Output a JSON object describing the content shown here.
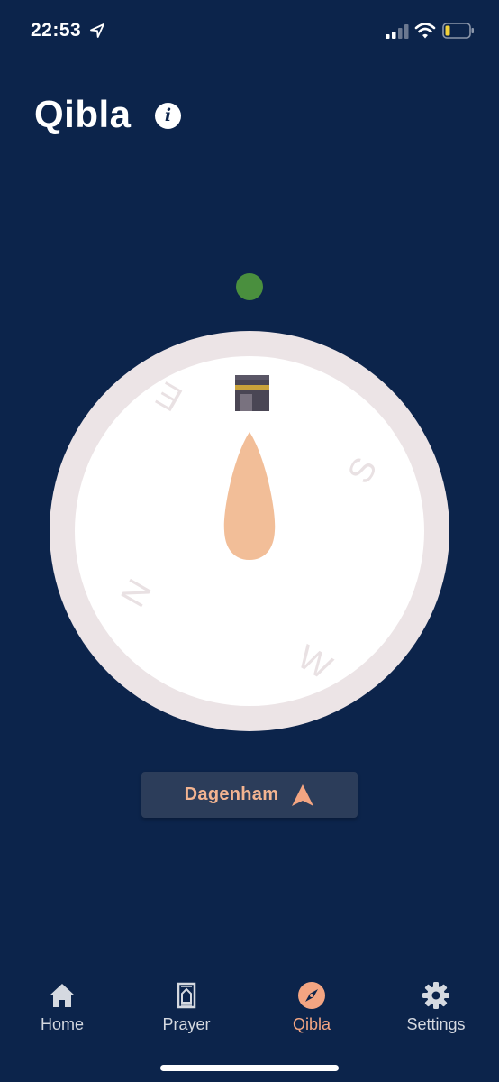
{
  "status_bar": {
    "time": "22:53",
    "icons": [
      "location-arrow-icon",
      "cellular-signal-icon",
      "wifi-icon",
      "battery-low-icon"
    ]
  },
  "header": {
    "title": "Qibla",
    "info_icon": "info-icon",
    "info_glyph": "i"
  },
  "compass": {
    "directions": {
      "north": "N",
      "east": "E",
      "south": "S",
      "west": "W"
    },
    "qibla_marker": "kaaba-icon",
    "aligned_indicator_color": "#4a8f3e",
    "needle_color": "#f2be98"
  },
  "location": {
    "name": "Dagenham",
    "icon": "navigation-arrow-icon"
  },
  "tab_bar": {
    "tabs": [
      {
        "label": "Home",
        "icon": "home-icon",
        "active": false
      },
      {
        "label": "Prayer",
        "icon": "prayer-mat-icon",
        "active": false
      },
      {
        "label": "Qibla",
        "icon": "compass-icon",
        "active": true
      },
      {
        "label": "Settings",
        "icon": "gear-icon",
        "active": false
      }
    ]
  },
  "colors": {
    "background": "#0c244b",
    "accent": "#f3a582",
    "button_bg": "#2c3d5a"
  }
}
